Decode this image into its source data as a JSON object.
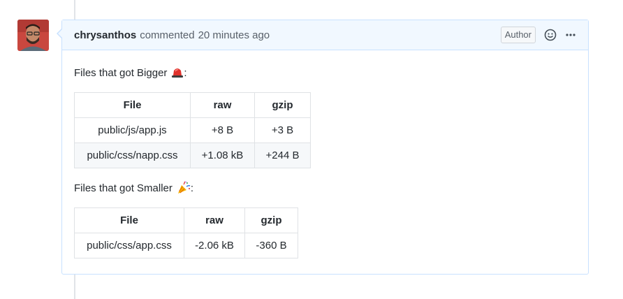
{
  "comment": {
    "author": "chrysanthos",
    "action": "commented",
    "timestamp": "20 minutes ago",
    "badge": "Author",
    "header_icons": [
      "smiley-icon",
      "kebab-icon"
    ]
  },
  "body": {
    "bigger_label": "Files that got Bigger",
    "bigger_emoji": "rotating-light-icon",
    "bigger_suffix": ":",
    "bigger_table": {
      "headers": [
        "File",
        "raw",
        "gzip"
      ],
      "rows": [
        [
          "public/js/app.js",
          "+8 B",
          "+3 B"
        ],
        [
          "public/css/napp.css",
          "+1.08 kB",
          "+244 B"
        ]
      ]
    },
    "smaller_label": "Files that got Smaller",
    "smaller_emoji": "party-popper-icon",
    "smaller_suffix": ":",
    "smaller_table": {
      "headers": [
        "File",
        "raw",
        "gzip"
      ],
      "rows": [
        [
          "public/css/app.css",
          "-2.06 kB",
          "-360 B"
        ]
      ]
    }
  },
  "colors": {
    "header_bg": "#f1f8ff",
    "border": "#c8e1ff",
    "text": "#24292e",
    "muted": "#586069"
  }
}
